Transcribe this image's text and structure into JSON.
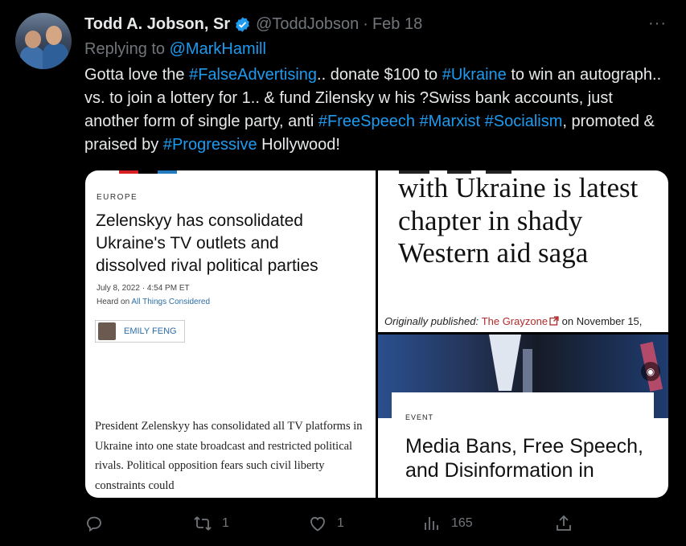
{
  "tweet": {
    "author_name": "Todd A. Jobson, Sr",
    "handle": "@ToddJobson",
    "separator": "·",
    "date": "Feb 18",
    "more_label": "···",
    "replying_to_prefix": "Replying to",
    "replying_to": "@MarkHamill",
    "text": {
      "p1": "Gotta love the ",
      "t1": "#FalseAdvertising",
      "p2": ".. donate $100 to ",
      "t2": "#Ukraine",
      "p3": " to win an autograph.. vs. to join a lottery for 1.. & fund Zilensky w his ?Swiss bank accounts, just another form of single party, anti ",
      "t3": "#FreeSpeech",
      "p4": " ",
      "t4": "#Marxist",
      "p5": " ",
      "t5": "#Socialism",
      "p6": ", promoted & praised by ",
      "t6": "#Progressive",
      "p7": " Hollywood!"
    }
  },
  "media": {
    "npr": {
      "section": "EUROPE",
      "headline": "Zelenskyy has consolidated Ukraine's TV outlets and dissolved rival political parties",
      "date": "July 8, 2022 · 4:54 PM ET",
      "heard_on_prefix": "Heard on ",
      "heard_on_program": "All Things Considered",
      "author": "EMILY FENG",
      "body": "President Zelenskyy has consolidated all TV platforms in Ukraine into one state broadcast and restricted political rivals. Political opposition fears such civil liberty constraints could"
    },
    "grayzone": {
      "title": "with Ukraine is latest chapter in shady Western aid saga",
      "origin_prefix": "Originally published: ",
      "origin_source": "The Grayzone",
      "origin_suffix": " on November 15,"
    },
    "event": {
      "label": "EVENT",
      "title": "Media Bans, Free Speech, and Disinformation in"
    }
  },
  "actions": {
    "reply_count": "",
    "retweet_count": "1",
    "like_count": "1",
    "views_count": "165"
  },
  "colors": {
    "background": "#000000",
    "accent": "#1d9bf0",
    "secondary_text": "#71767b",
    "primary_text": "#e7e9ea"
  }
}
